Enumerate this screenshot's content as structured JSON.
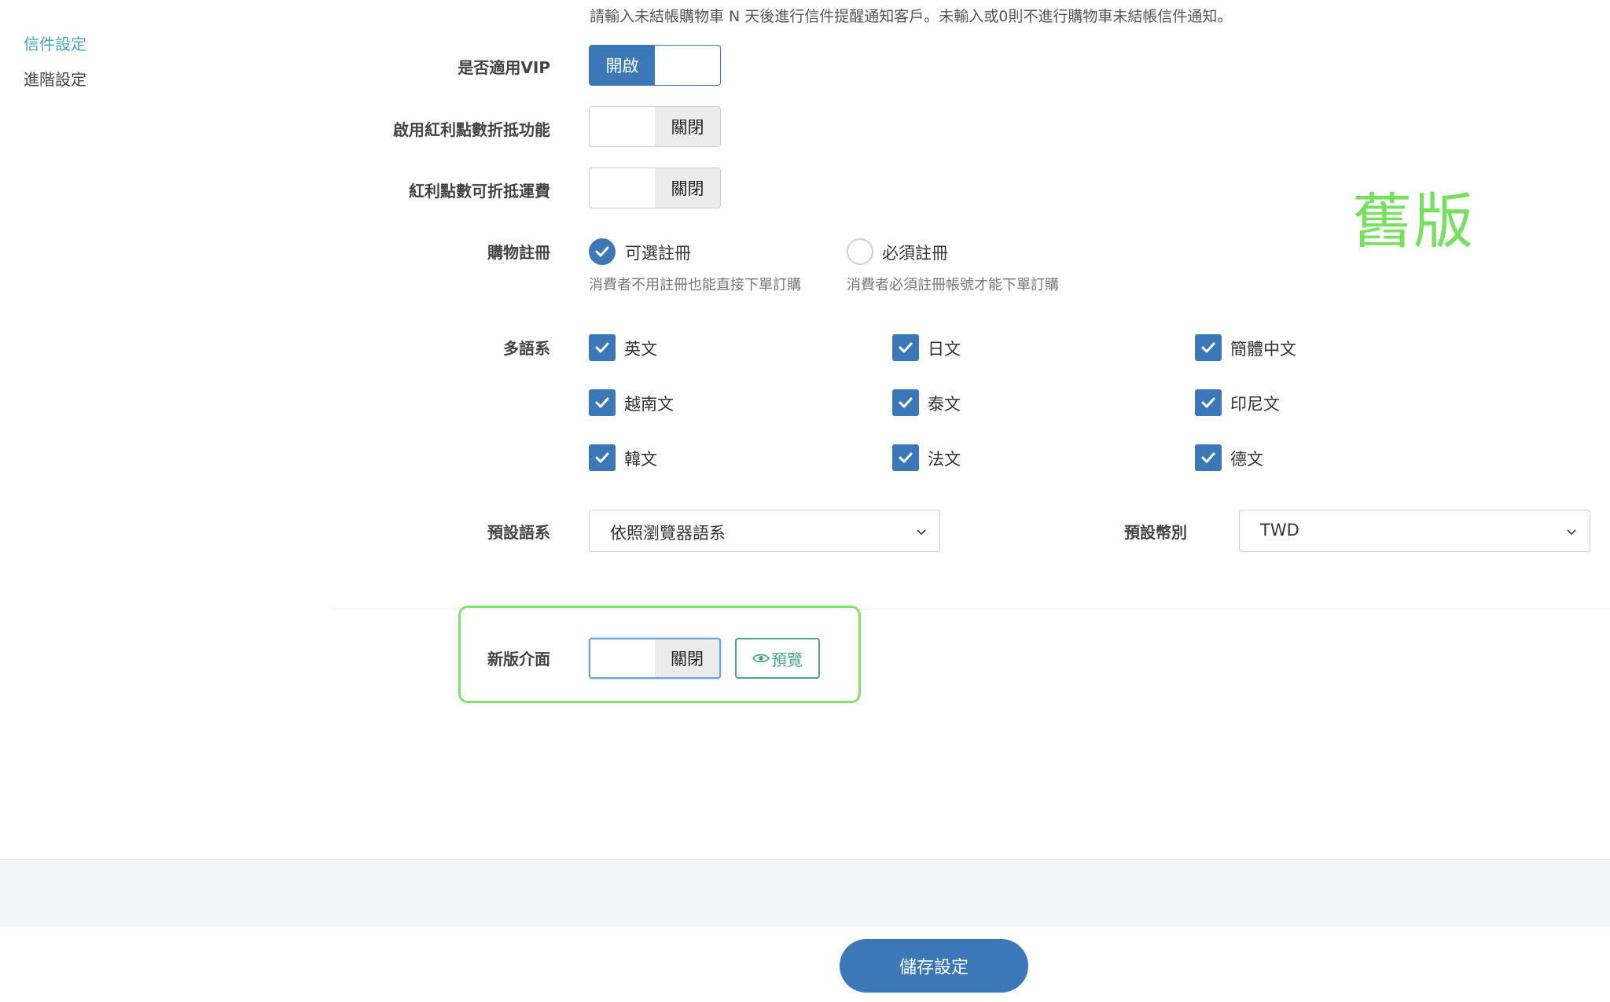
{
  "sidebar": {
    "items": [
      {
        "label": "信件設定"
      },
      {
        "label": "進階設定"
      }
    ]
  },
  "hint_text": "請輸入未結帳購物車 N 天後進行信件提醒通知客戶。未輸入或0則不進行購物車未結帳信件通知。",
  "vip": {
    "label": "是否適用VIP",
    "state": "開啟"
  },
  "bonus_discount": {
    "label": "啟用紅利點數折抵功能",
    "state": "關閉"
  },
  "bonus_shipping": {
    "label": "紅利點數可折抵運費",
    "state": "關閉"
  },
  "registration": {
    "label": "購物註冊",
    "options": [
      {
        "label": "可選註冊",
        "desc": "消費者不用註冊也能直接下單訂購",
        "checked": true
      },
      {
        "label": "必須註冊",
        "desc": "消費者必須註冊帳號才能下單訂購",
        "checked": false
      }
    ]
  },
  "languages": {
    "label": "多語系",
    "items": [
      {
        "label": "英文",
        "checked": true
      },
      {
        "label": "日文",
        "checked": true
      },
      {
        "label": "簡體中文",
        "checked": true
      },
      {
        "label": "越南文",
        "checked": true
      },
      {
        "label": "泰文",
        "checked": true
      },
      {
        "label": "印尼文",
        "checked": true
      },
      {
        "label": "韓文",
        "checked": true
      },
      {
        "label": "法文",
        "checked": true
      },
      {
        "label": "德文",
        "checked": true
      }
    ]
  },
  "default_language": {
    "label": "預設語系",
    "value": "依照瀏覽器語系"
  },
  "default_currency": {
    "label": "預設幣別",
    "value": "TWD"
  },
  "new_ui": {
    "label": "新版介面",
    "state": "關閉",
    "preview_label": "預覽"
  },
  "annotation": "舊版",
  "save_button": "儲存設定",
  "colors": {
    "primary": "#3c78b8",
    "accent_teal": "#47a7c0",
    "preview_green": "#4aa889",
    "highlight_green": "#7ee56a"
  }
}
